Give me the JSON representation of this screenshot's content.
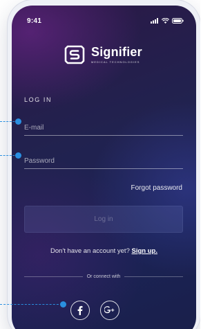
{
  "status_bar": {
    "time": "9:41"
  },
  "brand": {
    "name": "Signifier",
    "tagline": "MEDICAL TECHNOLOGIES",
    "logo_icon": "signifier-logo-icon"
  },
  "login": {
    "heading": "LOG IN",
    "email_placeholder": "E-mail",
    "email_value": "",
    "password_placeholder": "Password",
    "password_value": "",
    "forgot_label": "Forgot password",
    "submit_label": "Log in"
  },
  "signup": {
    "prompt": "Don't have an account yet?",
    "link_label": "Sign up."
  },
  "social": {
    "divider_label": "Or connect with",
    "facebook_icon": "facebook-icon",
    "google_plus_icon": "google-plus-icon"
  },
  "colors": {
    "annotation": "#2a8fe0",
    "screen_bg": "#1f2352",
    "text": "#ffffff"
  }
}
